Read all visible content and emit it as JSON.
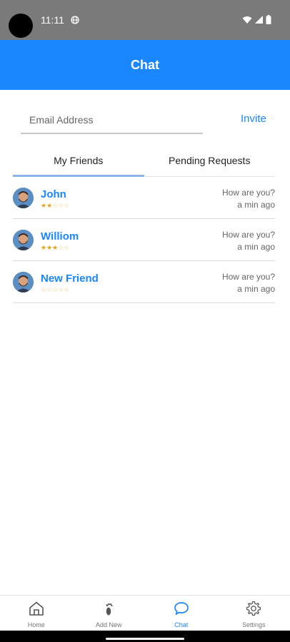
{
  "status_bar": {
    "time": "11:11"
  },
  "header": {
    "title": "Chat"
  },
  "invite": {
    "email_placeholder": "Email Address",
    "email_value": "",
    "invite_label": "Invite"
  },
  "tabs": [
    {
      "label": "My Friends",
      "active": true
    },
    {
      "label": "Pending Requests",
      "active": false
    }
  ],
  "friends": [
    {
      "name": "John",
      "rating": 2,
      "rating_max": 5,
      "last_message": "How are you?",
      "time": "a min ago"
    },
    {
      "name": "Williom",
      "rating": 3,
      "rating_max": 5,
      "last_message": "How are you?",
      "time": "a min ago"
    },
    {
      "name": "New Friend",
      "rating": 0,
      "rating_max": 5,
      "last_message": "How are you?",
      "time": "a min ago"
    }
  ],
  "bottom_nav": [
    {
      "label": "Home",
      "icon": "home-icon",
      "active": false
    },
    {
      "label": "Add New",
      "icon": "footprint-icon",
      "active": false
    },
    {
      "label": "Chat",
      "icon": "chat-bubble-icon",
      "active": true
    },
    {
      "label": "Settings",
      "icon": "gear-icon",
      "active": false
    }
  ],
  "colors": {
    "accent": "#1a86ff",
    "status_bar": "#7a7a7a",
    "star": "#e8a317"
  }
}
